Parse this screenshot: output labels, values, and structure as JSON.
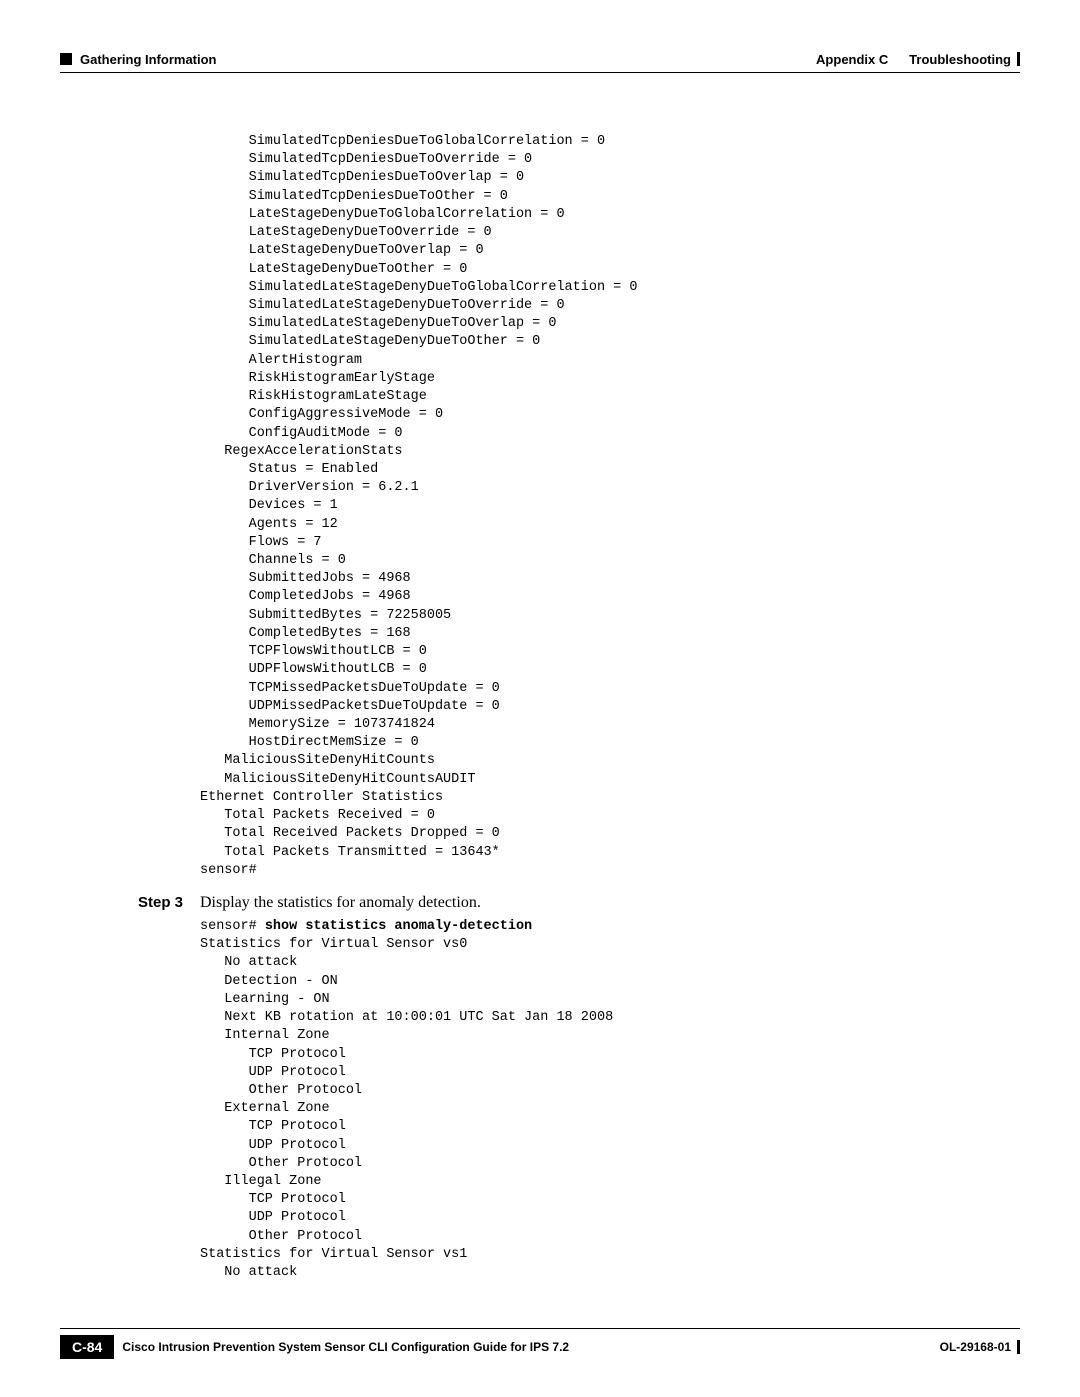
{
  "header": {
    "left_section": "Gathering Information",
    "right_appendix": "Appendix C",
    "right_title": "Troubleshooting"
  },
  "code_block_1": "      SimulatedTcpDeniesDueToGlobalCorrelation = 0\n      SimulatedTcpDeniesDueToOverride = 0\n      SimulatedTcpDeniesDueToOverlap = 0\n      SimulatedTcpDeniesDueToOther = 0\n      LateStageDenyDueToGlobalCorrelation = 0\n      LateStageDenyDueToOverride = 0\n      LateStageDenyDueToOverlap = 0\n      LateStageDenyDueToOther = 0\n      SimulatedLateStageDenyDueToGlobalCorrelation = 0\n      SimulatedLateStageDenyDueToOverride = 0\n      SimulatedLateStageDenyDueToOverlap = 0\n      SimulatedLateStageDenyDueToOther = 0\n      AlertHistogram\n      RiskHistogramEarlyStage\n      RiskHistogramLateStage\n      ConfigAggressiveMode = 0\n      ConfigAuditMode = 0\n   RegexAccelerationStats\n      Status = Enabled\n      DriverVersion = 6.2.1\n      Devices = 1\n      Agents = 12\n      Flows = 7\n      Channels = 0\n      SubmittedJobs = 4968\n      CompletedJobs = 4968\n      SubmittedBytes = 72258005\n      CompletedBytes = 168\n      TCPFlowsWithoutLCB = 0\n      UDPFlowsWithoutLCB = 0\n      TCPMissedPacketsDueToUpdate = 0\n      UDPMissedPacketsDueToUpdate = 0\n      MemorySize = 1073741824\n      HostDirectMemSize = 0\n   MaliciousSiteDenyHitCounts\n   MaliciousSiteDenyHitCountsAUDIT\nEthernet Controller Statistics\n   Total Packets Received = 0\n   Total Received Packets Dropped = 0\n   Total Packets Transmitted = 13643*\nsensor#",
  "step": {
    "label": "Step 3",
    "text": "Display the statistics for anomaly detection."
  },
  "code_block_2_prompt": "sensor# ",
  "code_block_2_cmd": "show statistics anomaly-detection",
  "code_block_2_body": "Statistics for Virtual Sensor vs0\n   No attack\n   Detection - ON\n   Learning - ON\n   Next KB rotation at 10:00:01 UTC Sat Jan 18 2008\n   Internal Zone\n      TCP Protocol\n      UDP Protocol\n      Other Protocol\n   External Zone\n      TCP Protocol\n      UDP Protocol\n      Other Protocol\n   Illegal Zone\n      TCP Protocol\n      UDP Protocol\n      Other Protocol\nStatistics for Virtual Sensor vs1\n   No attack",
  "footer": {
    "doc_title": "Cisco Intrusion Prevention System Sensor CLI Configuration Guide for IPS 7.2",
    "page_number": "C-84",
    "doc_id": "OL-29168-01"
  }
}
